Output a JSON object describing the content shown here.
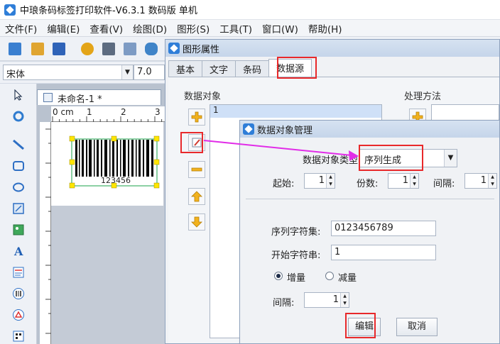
{
  "app": {
    "title": "中琅条码标签打印软件-V6.3.1 数码版 单机"
  },
  "menu": [
    {
      "label": "文件(F)"
    },
    {
      "label": "编辑(E)"
    },
    {
      "label": "查看(V)"
    },
    {
      "label": "绘图(D)"
    },
    {
      "label": "图形(S)"
    },
    {
      "label": "工具(T)"
    },
    {
      "label": "窗口(W)"
    },
    {
      "label": "帮助(H)"
    }
  ],
  "font": {
    "name": "宋体",
    "size": "7.0"
  },
  "document": {
    "tab_label": "未命名-1 *",
    "ruler_start": "0 cm",
    "ruler_marks": [
      "1",
      "2",
      "3"
    ],
    "barcode_text": "123456"
  },
  "props_dialog": {
    "title": "图形属性",
    "tabs": [
      {
        "label": "基本"
      },
      {
        "label": "文字"
      },
      {
        "label": "条码"
      },
      {
        "label": "数据源"
      }
    ],
    "data_objects_label": "数据对象",
    "processing_label": "处理方法",
    "list_items": [
      "1"
    ]
  },
  "manager_dialog": {
    "title": "数据对象管理",
    "type_label": "数据对象类型:",
    "type_value": "序列生成",
    "start_label": "起始:",
    "start_value": "1",
    "copies_label": "份数:",
    "copies_value": "1",
    "interval_label": "间隔:",
    "interval_value": "1",
    "charset_label": "序列字符集:",
    "charset_value": "0123456789",
    "start_string_label": "开始字符串:",
    "start_string_value": "1",
    "increment_label": "增量",
    "decrement_label": "减量",
    "step_label": "间隔:",
    "step_value": "1",
    "edit_button": "编辑",
    "cancel_button": "取消"
  },
  "colors": {
    "highlight": "#e8292b",
    "arrow": "#e12ce8",
    "selection": "#cfe0f7"
  }
}
